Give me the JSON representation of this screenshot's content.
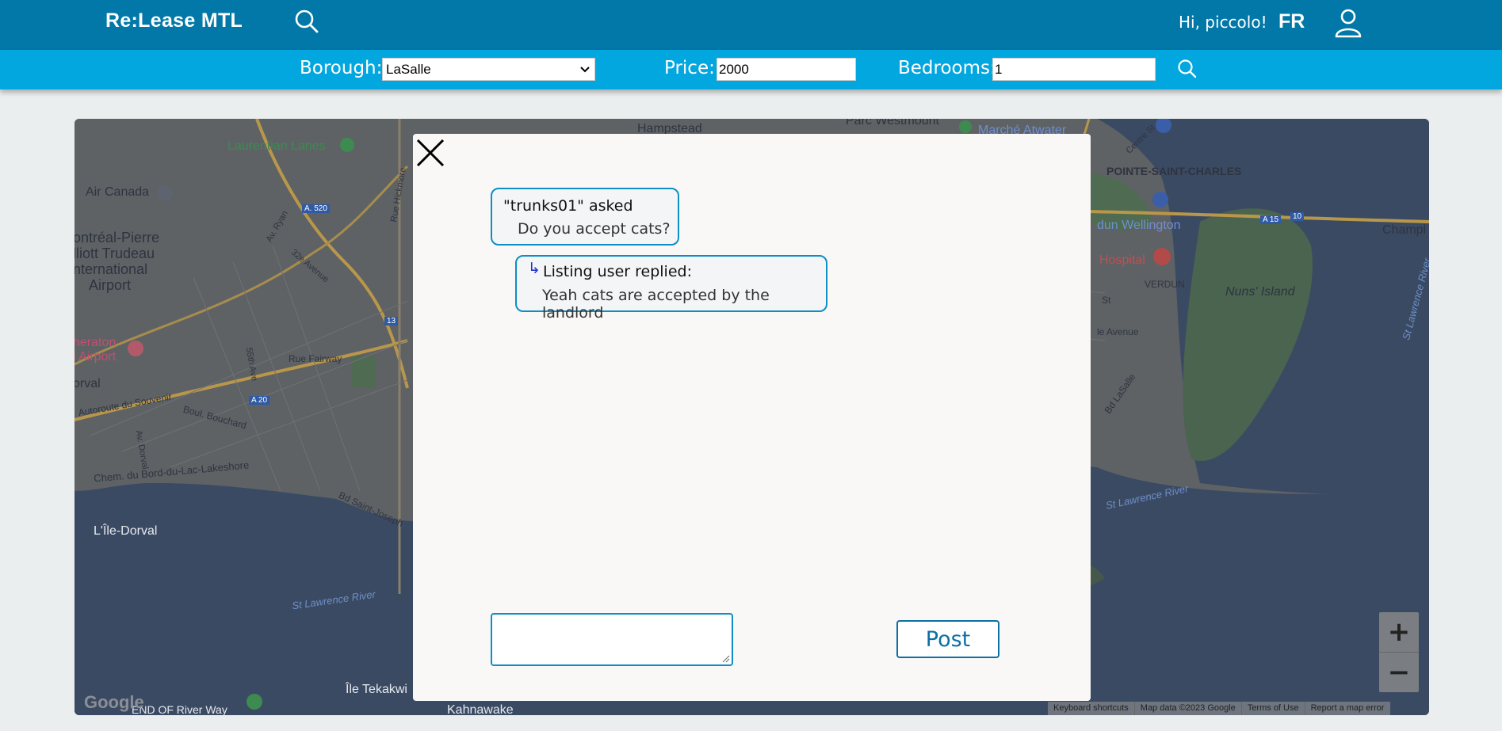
{
  "header": {
    "logo": "Re:Lease MTL",
    "greeting": "Hi, piccolo!",
    "language_toggle": "FR",
    "search_icon": "search-icon",
    "user_icon": "user-icon"
  },
  "filters": {
    "borough_label": "Borough:",
    "borough_value": "LaSalle",
    "price_label": "Price:",
    "price_value": "2000",
    "bedrooms_label": "Bedrooms:",
    "bedrooms_value": "1",
    "search_icon": "search-icon"
  },
  "map": {
    "labels": {
      "hampstead": "Hampstead",
      "parc_westmount": "Parc Westmount",
      "marche_atwater": "Marché Atwater",
      "laurentian_lanes": "Laurentian Lanes",
      "air_canada": "Air Canada",
      "pointe_saint_charles": "POINTE-SAINT-CHARLES",
      "airport_1": "ontréal-Pierre",
      "airport_2": "lliott Trudeau",
      "airport_3": "nternational",
      "airport_4": "Airport",
      "dun_wellington": "dun Wellington",
      "hospital": "Hospital",
      "verdun": "VERDUN",
      "nuns_island": "Nuns' Island",
      "sheraton_1": "heraton",
      "sheraton_2": "l Airport",
      "dorval": "orval",
      "rue_fairway": "Rue Fairway",
      "autoroute": "Autoroute du Souvenir",
      "boul_bouchard": "Boul. Bouchard",
      "chemin": "Chem. du Bord-du-Lac-Lakeshore",
      "ile_dorval": "L'Île-Dorval",
      "st_lawrence_1": "St Lawrence River",
      "st_lawrence_2": "St Lawrence River",
      "st_lawrence_3": "St Lawrence River",
      "ile_tekakwi": "Île Tekakwi",
      "kahnawake": "Kahnawake",
      "end_of_river_way": "END OF River Way",
      "bd_lasalle": "Bd LaSalle",
      "champl": "Champl",
      "le_avenue": "le Avenue",
      "st": "St",
      "ave_ryan": "Av. Ryan",
      "ave_32e": "32e Avenue",
      "ave_55th": "55th Ave",
      "av_dorval": "Av. Dorval",
      "bd_saint_joseph": "Bd Saint-Joseph",
      "rue_hickmore": "Rue Hickmore",
      "a520": "A. 520",
      "a20": "A 20",
      "a15": "A 15",
      "r13": "13",
      "r10": "10",
      "centre_st": "Centre St"
    },
    "zoom_in": "+",
    "zoom_out": "−",
    "google": "Google",
    "attribution": [
      "Keyboard shortcuts",
      "Map data ©2023 Google",
      "Terms of Use",
      "Report a map error"
    ]
  },
  "modal": {
    "question_author": "\"trunks01\" asked",
    "question_text": "Do you accept cats?",
    "reply_arrow": "↳",
    "reply_author": "Listing user replied:",
    "reply_text": "Yeah cats are accepted by the landlord",
    "textarea_value": "",
    "post_label": "Post"
  },
  "colors": {
    "header_bg": "#0278a8",
    "filterbar_bg": "#02a7df",
    "accent": "#0d8fc6",
    "modal_bg": "#f9f8f6"
  }
}
